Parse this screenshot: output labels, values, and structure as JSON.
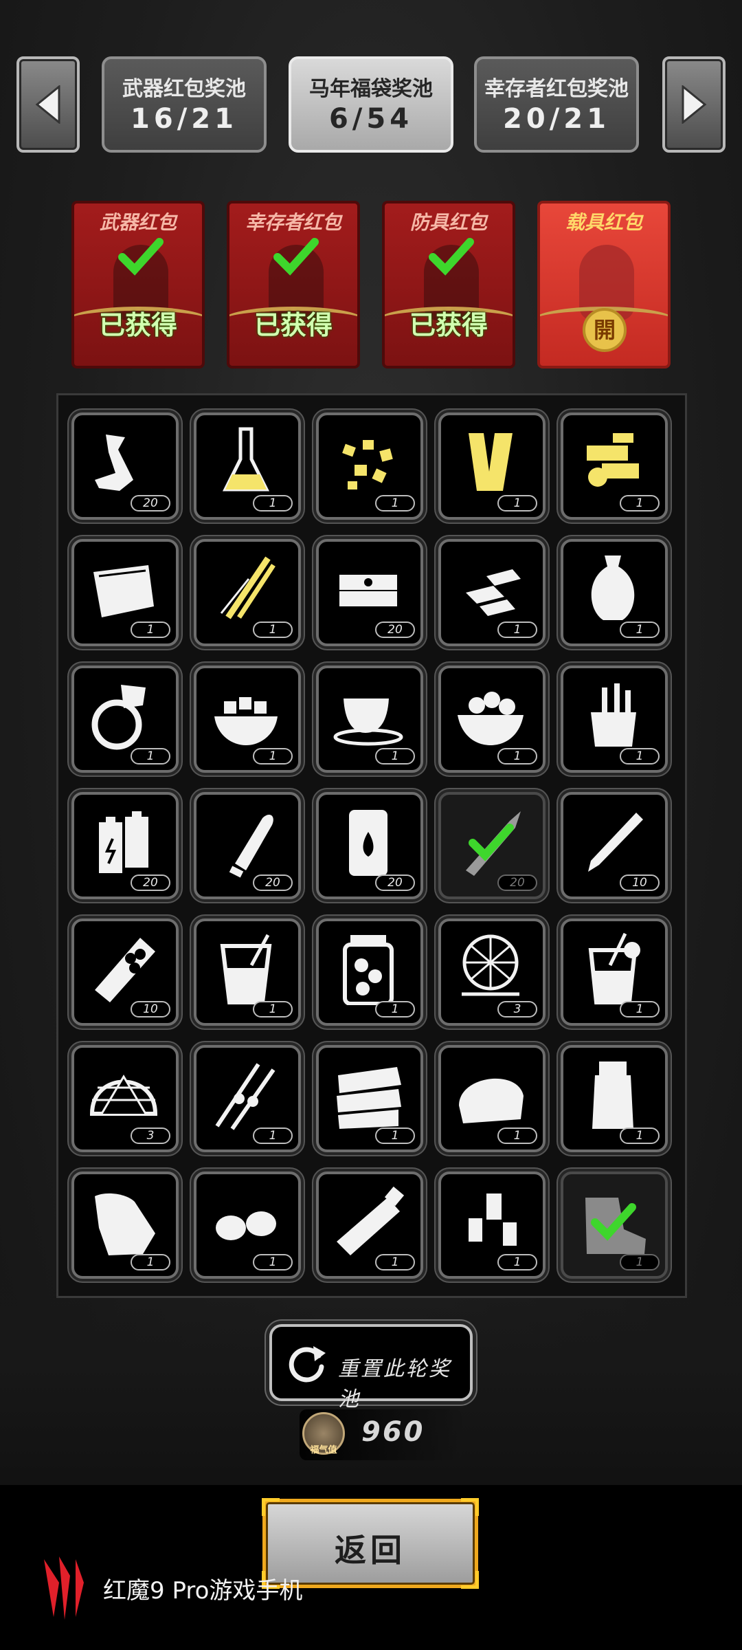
{
  "pools": {
    "tabs": [
      {
        "title": "武器红包奖池",
        "count": "16/21",
        "active": false
      },
      {
        "title": "马年福袋奖池",
        "count": "6/54",
        "active": true
      },
      {
        "title": "幸存者红包奖池",
        "count": "20/21",
        "active": false
      }
    ]
  },
  "envelopes": [
    {
      "title": "武器红包",
      "status": "已获得",
      "state": "obtained"
    },
    {
      "title": "幸存者红包",
      "status": "已获得",
      "state": "obtained"
    },
    {
      "title": "防具红包",
      "status": "已获得",
      "state": "obtained"
    },
    {
      "title": "载具红包",
      "seal": "開",
      "state": "open"
    }
  ],
  "items": [
    {
      "icon": "tape-roll-icon",
      "count": "20",
      "owned": false
    },
    {
      "icon": "flask-icon",
      "count": "1",
      "owned": false
    },
    {
      "icon": "gold-nuggets-icon",
      "count": "1",
      "owned": false
    },
    {
      "icon": "wood-planks-icon",
      "count": "1",
      "owned": false
    },
    {
      "icon": "gold-gears-icon",
      "count": "1",
      "owned": false
    },
    {
      "icon": "cloth-icon",
      "count": "1",
      "owned": false
    },
    {
      "icon": "bamboo-sticks-icon",
      "count": "1",
      "owned": false
    },
    {
      "icon": "cash-stack-icon",
      "count": "20",
      "owned": false
    },
    {
      "icon": "silver-bars-icon",
      "count": "1",
      "owned": false
    },
    {
      "icon": "vase-icon",
      "count": "1",
      "owned": false
    },
    {
      "icon": "diamond-ring-icon",
      "count": "1",
      "owned": false
    },
    {
      "icon": "tofu-bowl-icon",
      "count": "1",
      "owned": false
    },
    {
      "icon": "coffee-cup-icon",
      "count": "1",
      "owned": false
    },
    {
      "icon": "food-bowl-icon",
      "count": "1",
      "owned": false
    },
    {
      "icon": "tools-box-icon",
      "count": "1",
      "owned": false
    },
    {
      "icon": "batteries-icon",
      "count": "20",
      "owned": false
    },
    {
      "icon": "bullet-icon",
      "count": "20",
      "owned": false
    },
    {
      "icon": "fuel-barrel-icon",
      "count": "20",
      "owned": false
    },
    {
      "icon": "rifle-round-icon",
      "count": "20",
      "owned": true
    },
    {
      "icon": "pen-icon",
      "count": "10",
      "owned": false
    },
    {
      "icon": "pill-tube-icon",
      "count": "10",
      "owned": false
    },
    {
      "icon": "drink-glass-icon",
      "count": "1",
      "owned": false
    },
    {
      "icon": "pickle-jar-icon",
      "count": "1",
      "owned": false
    },
    {
      "icon": "net-trap-icon",
      "count": "3",
      "owned": false
    },
    {
      "icon": "juice-glass-icon",
      "count": "1",
      "owned": false
    },
    {
      "icon": "dome-net-icon",
      "count": "3",
      "owned": false
    },
    {
      "icon": "skewers-icon",
      "count": "1",
      "owned": false
    },
    {
      "icon": "layered-cake-icon",
      "count": "1",
      "owned": false
    },
    {
      "icon": "bread-loaf-icon",
      "count": "1",
      "owned": false
    },
    {
      "icon": "bottle-icon",
      "count": "1",
      "owned": false
    },
    {
      "icon": "bandage-icon",
      "count": "1",
      "owned": false
    },
    {
      "icon": "eggs-icon",
      "count": "1",
      "owned": false
    },
    {
      "icon": "ointment-tube-icon",
      "count": "1",
      "owned": false
    },
    {
      "icon": "pill-bottles-icon",
      "count": "1",
      "owned": false
    },
    {
      "icon": "boot-icon",
      "count": "1",
      "owned": true
    }
  ],
  "reset_label": "重置此轮奖池",
  "fortune": {
    "icon_label": "福气值",
    "value": "960"
  },
  "back_label": "返回",
  "brand": {
    "text": "红魔9 Pro游戏手机"
  },
  "colors": {
    "check": "#3ed62c",
    "envelope_red": "#a31c1c",
    "envelope_open": "#e8473a",
    "back_border": "#f0a91e"
  }
}
